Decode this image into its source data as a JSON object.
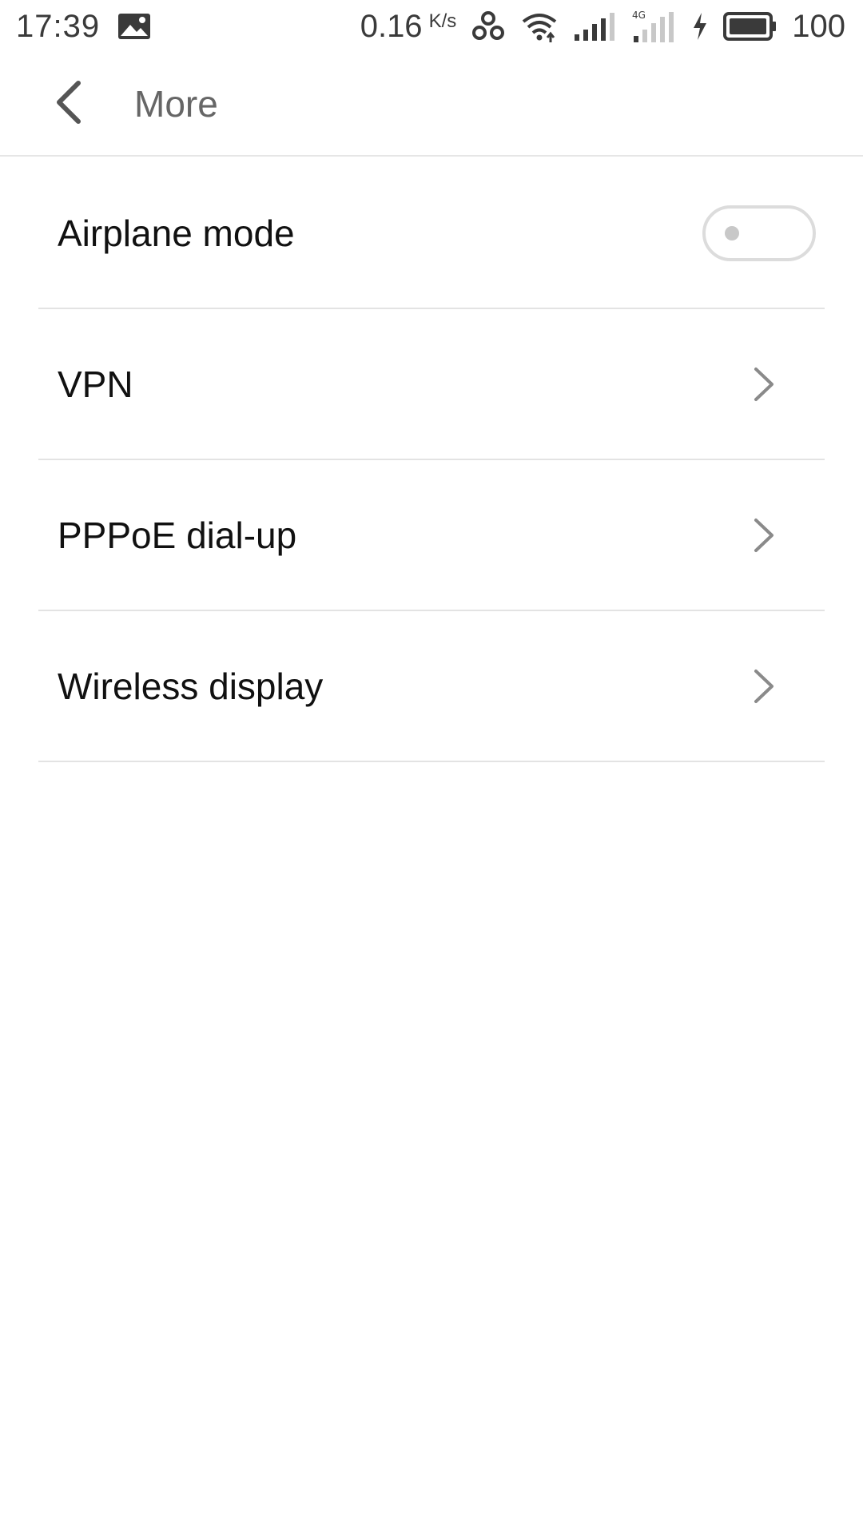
{
  "status_bar": {
    "time": "17:39",
    "net_speed": "0.16",
    "net_unit": "K/s",
    "battery": "100",
    "icons": [
      "gallery-icon",
      "link-icon",
      "wifi-icon",
      "signal-icon",
      "signal-4g-icon",
      "charging-icon",
      "battery-icon"
    ]
  },
  "header": {
    "title": "More",
    "back_icon": "back-arrow-icon"
  },
  "settings": {
    "items": [
      {
        "label": "Airplane mode",
        "control": "toggle",
        "toggle_on": false
      },
      {
        "label": "VPN",
        "control": "chevron"
      },
      {
        "label": "PPPoE dial-up",
        "control": "chevron"
      },
      {
        "label": "Wireless display",
        "control": "chevron"
      }
    ]
  },
  "colors": {
    "background": "#ffffff",
    "text_primary": "#111111",
    "text_secondary": "#666666",
    "divider": "#e3e3e3",
    "icon_gray": "#8a8a8a"
  }
}
